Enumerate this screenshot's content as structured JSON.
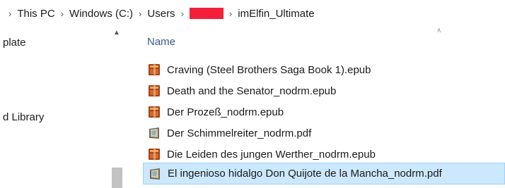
{
  "breadcrumb": {
    "items": [
      "This PC",
      "Windows (C:)",
      "Users",
      "imElfin_Ultimate"
    ]
  },
  "nav": {
    "items": [
      {
        "label": "plate"
      },
      {
        "label": "d Library"
      }
    ]
  },
  "list": {
    "column_name": "Name",
    "files": [
      {
        "name": "Craving (Steel Brothers Saga Book 1).epub",
        "icon": "epub-file-icon"
      },
      {
        "name": "Death and the Senator_nodrm.epub",
        "icon": "epub-file-icon"
      },
      {
        "name": "Der Prozeß_nodrm.epub",
        "icon": "epub-file-icon"
      },
      {
        "name": "Der Schimmelreiter_nodrm.pdf",
        "icon": "pdf-file-icon"
      },
      {
        "name": "Die Leiden des jungen Werther_nodrm.epub",
        "icon": "epub-file-icon"
      },
      {
        "name": "El ingenioso hidalgo Don Quijote de la Mancha_nodrm.pdf",
        "icon": "pdf-file-icon",
        "selected": true
      }
    ]
  },
  "colors": {
    "selection_bg": "#cce8ff",
    "selection_border": "#99d1ff",
    "redaction": "#f41f3b",
    "header_text": "#3a5a8a"
  }
}
